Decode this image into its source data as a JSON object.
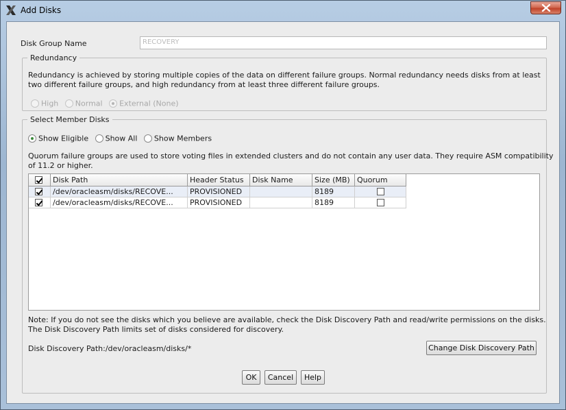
{
  "window": {
    "title": "Add Disks",
    "icon": "x-window-icon",
    "close_icon": "close-icon"
  },
  "disk_group": {
    "label": "Disk Group Name",
    "value": "RECOVERY"
  },
  "redundancy": {
    "legend": "Redundancy",
    "description_line1": "Redundancy is achieved by storing multiple copies of the data on different failure groups. Normal redundancy needs disks from at least",
    "description_line2": "two different failure groups, and high redundancy from at least three different failure groups.",
    "options": [
      {
        "label": "High",
        "selected": false
      },
      {
        "label": "Normal",
        "selected": false
      },
      {
        "label": "External (None)",
        "selected": true
      }
    ]
  },
  "member_disks": {
    "legend": "Select Member Disks",
    "filters": [
      {
        "label": "Show Eligible",
        "selected": true
      },
      {
        "label": "Show All",
        "selected": false
      },
      {
        "label": "Show Members",
        "selected": false
      }
    ],
    "quorum_line1": "Quorum failure groups are used to store voting files in extended clusters and do not contain any user data. They require ASM compatibility",
    "quorum_line2": "of 11.2 or higher.",
    "table": {
      "columns": [
        "",
        "Disk Path",
        "Header Status",
        "Disk Name",
        "Size (MB)",
        "Quorum"
      ],
      "header_checked": true,
      "rows": [
        {
          "selected": true,
          "path": "/dev/oracleasm/disks/RECOVE...",
          "status": "PROVISIONED",
          "name": "",
          "size": "8189",
          "quorum": false
        },
        {
          "selected": true,
          "path": "/dev/oracleasm/disks/RECOVE...",
          "status": "PROVISIONED",
          "name": "",
          "size": "8189",
          "quorum": false
        }
      ]
    },
    "note_line1": "Note: If you do not see the disks which you believe are available, check the Disk Discovery Path and read/write permissions on the disks.",
    "note_line2": "The Disk Discovery Path limits set of disks considered for discovery.",
    "discovery_path_label": "Disk Discovery Path:/dev/oracleasm/disks/*",
    "change_path_button": "Change Disk Discovery Path"
  },
  "buttons": {
    "ok": "OK",
    "cancel": "Cancel",
    "help": "Help"
  }
}
